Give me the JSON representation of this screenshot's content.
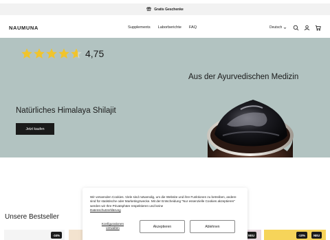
{
  "announcement": {
    "text": "Gratis Geschenke",
    "icon": "gift-icon"
  },
  "header": {
    "logo": "NAUMUNA",
    "nav": [
      "Supplements",
      "Laborberichte",
      "FAQ"
    ],
    "language": "Deutsch"
  },
  "hero": {
    "stars": 4.75,
    "rating_text": "4,75",
    "tagline": "Aus der Ayurvedischen Medizin",
    "headline": "Natürliches Himalaya Shilajit",
    "cta": "Jetzt kaufen",
    "background": "#b2c3c1",
    "star_color": "#f1c42c"
  },
  "bestsellers": {
    "title": "Unsere Bestseller",
    "badges": [
      "-34%",
      "NEU",
      "-10%",
      "NEU"
    ]
  },
  "cookie": {
    "text": "Wir verwenden Cookies. Viele sind notwendig, um die Website und ihre Funktionen zu betreiben, andere sind für statistische oder Marketingzwecke. Mit der Entscheidung \"Nur essenzielle Cookies akzeptieren\" werden wir Ihre Privatsphäre respektieren und keine",
    "link": "Datenschutzerklärung",
    "configure": "Konfigurationen verwalten",
    "accept": "Akzeptieren",
    "decline": "Ablehnen"
  }
}
